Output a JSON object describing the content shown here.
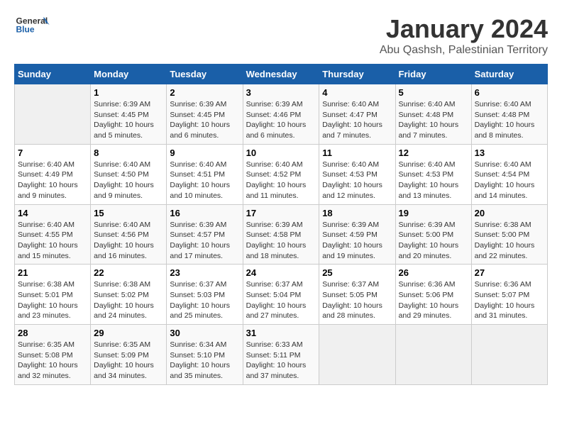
{
  "logo": {
    "general": "General",
    "blue": "Blue"
  },
  "title": "January 2024",
  "subtitle": "Abu Qashsh, Palestinian Territory",
  "headers": [
    "Sunday",
    "Monday",
    "Tuesday",
    "Wednesday",
    "Thursday",
    "Friday",
    "Saturday"
  ],
  "weeks": [
    [
      {
        "day": "",
        "sunrise": "",
        "sunset": "",
        "daylight": ""
      },
      {
        "day": "1",
        "sunrise": "Sunrise: 6:39 AM",
        "sunset": "Sunset: 4:45 PM",
        "daylight": "Daylight: 10 hours and 5 minutes."
      },
      {
        "day": "2",
        "sunrise": "Sunrise: 6:39 AM",
        "sunset": "Sunset: 4:45 PM",
        "daylight": "Daylight: 10 hours and 6 minutes."
      },
      {
        "day": "3",
        "sunrise": "Sunrise: 6:39 AM",
        "sunset": "Sunset: 4:46 PM",
        "daylight": "Daylight: 10 hours and 6 minutes."
      },
      {
        "day": "4",
        "sunrise": "Sunrise: 6:40 AM",
        "sunset": "Sunset: 4:47 PM",
        "daylight": "Daylight: 10 hours and 7 minutes."
      },
      {
        "day": "5",
        "sunrise": "Sunrise: 6:40 AM",
        "sunset": "Sunset: 4:48 PM",
        "daylight": "Daylight: 10 hours and 7 minutes."
      },
      {
        "day": "6",
        "sunrise": "Sunrise: 6:40 AM",
        "sunset": "Sunset: 4:48 PM",
        "daylight": "Daylight: 10 hours and 8 minutes."
      }
    ],
    [
      {
        "day": "7",
        "sunrise": "Sunrise: 6:40 AM",
        "sunset": "Sunset: 4:49 PM",
        "daylight": "Daylight: 10 hours and 9 minutes."
      },
      {
        "day": "8",
        "sunrise": "Sunrise: 6:40 AM",
        "sunset": "Sunset: 4:50 PM",
        "daylight": "Daylight: 10 hours and 9 minutes."
      },
      {
        "day": "9",
        "sunrise": "Sunrise: 6:40 AM",
        "sunset": "Sunset: 4:51 PM",
        "daylight": "Daylight: 10 hours and 10 minutes."
      },
      {
        "day": "10",
        "sunrise": "Sunrise: 6:40 AM",
        "sunset": "Sunset: 4:52 PM",
        "daylight": "Daylight: 10 hours and 11 minutes."
      },
      {
        "day": "11",
        "sunrise": "Sunrise: 6:40 AM",
        "sunset": "Sunset: 4:53 PM",
        "daylight": "Daylight: 10 hours and 12 minutes."
      },
      {
        "day": "12",
        "sunrise": "Sunrise: 6:40 AM",
        "sunset": "Sunset: 4:53 PM",
        "daylight": "Daylight: 10 hours and 13 minutes."
      },
      {
        "day": "13",
        "sunrise": "Sunrise: 6:40 AM",
        "sunset": "Sunset: 4:54 PM",
        "daylight": "Daylight: 10 hours and 14 minutes."
      }
    ],
    [
      {
        "day": "14",
        "sunrise": "Sunrise: 6:40 AM",
        "sunset": "Sunset: 4:55 PM",
        "daylight": "Daylight: 10 hours and 15 minutes."
      },
      {
        "day": "15",
        "sunrise": "Sunrise: 6:40 AM",
        "sunset": "Sunset: 4:56 PM",
        "daylight": "Daylight: 10 hours and 16 minutes."
      },
      {
        "day": "16",
        "sunrise": "Sunrise: 6:39 AM",
        "sunset": "Sunset: 4:57 PM",
        "daylight": "Daylight: 10 hours and 17 minutes."
      },
      {
        "day": "17",
        "sunrise": "Sunrise: 6:39 AM",
        "sunset": "Sunset: 4:58 PM",
        "daylight": "Daylight: 10 hours and 18 minutes."
      },
      {
        "day": "18",
        "sunrise": "Sunrise: 6:39 AM",
        "sunset": "Sunset: 4:59 PM",
        "daylight": "Daylight: 10 hours and 19 minutes."
      },
      {
        "day": "19",
        "sunrise": "Sunrise: 6:39 AM",
        "sunset": "Sunset: 5:00 PM",
        "daylight": "Daylight: 10 hours and 20 minutes."
      },
      {
        "day": "20",
        "sunrise": "Sunrise: 6:38 AM",
        "sunset": "Sunset: 5:00 PM",
        "daylight": "Daylight: 10 hours and 22 minutes."
      }
    ],
    [
      {
        "day": "21",
        "sunrise": "Sunrise: 6:38 AM",
        "sunset": "Sunset: 5:01 PM",
        "daylight": "Daylight: 10 hours and 23 minutes."
      },
      {
        "day": "22",
        "sunrise": "Sunrise: 6:38 AM",
        "sunset": "Sunset: 5:02 PM",
        "daylight": "Daylight: 10 hours and 24 minutes."
      },
      {
        "day": "23",
        "sunrise": "Sunrise: 6:37 AM",
        "sunset": "Sunset: 5:03 PM",
        "daylight": "Daylight: 10 hours and 25 minutes."
      },
      {
        "day": "24",
        "sunrise": "Sunrise: 6:37 AM",
        "sunset": "Sunset: 5:04 PM",
        "daylight": "Daylight: 10 hours and 27 minutes."
      },
      {
        "day": "25",
        "sunrise": "Sunrise: 6:37 AM",
        "sunset": "Sunset: 5:05 PM",
        "daylight": "Daylight: 10 hours and 28 minutes."
      },
      {
        "day": "26",
        "sunrise": "Sunrise: 6:36 AM",
        "sunset": "Sunset: 5:06 PM",
        "daylight": "Daylight: 10 hours and 29 minutes."
      },
      {
        "day": "27",
        "sunrise": "Sunrise: 6:36 AM",
        "sunset": "Sunset: 5:07 PM",
        "daylight": "Daylight: 10 hours and 31 minutes."
      }
    ],
    [
      {
        "day": "28",
        "sunrise": "Sunrise: 6:35 AM",
        "sunset": "Sunset: 5:08 PM",
        "daylight": "Daylight: 10 hours and 32 minutes."
      },
      {
        "day": "29",
        "sunrise": "Sunrise: 6:35 AM",
        "sunset": "Sunset: 5:09 PM",
        "daylight": "Daylight: 10 hours and 34 minutes."
      },
      {
        "day": "30",
        "sunrise": "Sunrise: 6:34 AM",
        "sunset": "Sunset: 5:10 PM",
        "daylight": "Daylight: 10 hours and 35 minutes."
      },
      {
        "day": "31",
        "sunrise": "Sunrise: 6:33 AM",
        "sunset": "Sunset: 5:11 PM",
        "daylight": "Daylight: 10 hours and 37 minutes."
      },
      {
        "day": "",
        "sunrise": "",
        "sunset": "",
        "daylight": ""
      },
      {
        "day": "",
        "sunrise": "",
        "sunset": "",
        "daylight": ""
      },
      {
        "day": "",
        "sunrise": "",
        "sunset": "",
        "daylight": ""
      }
    ]
  ]
}
